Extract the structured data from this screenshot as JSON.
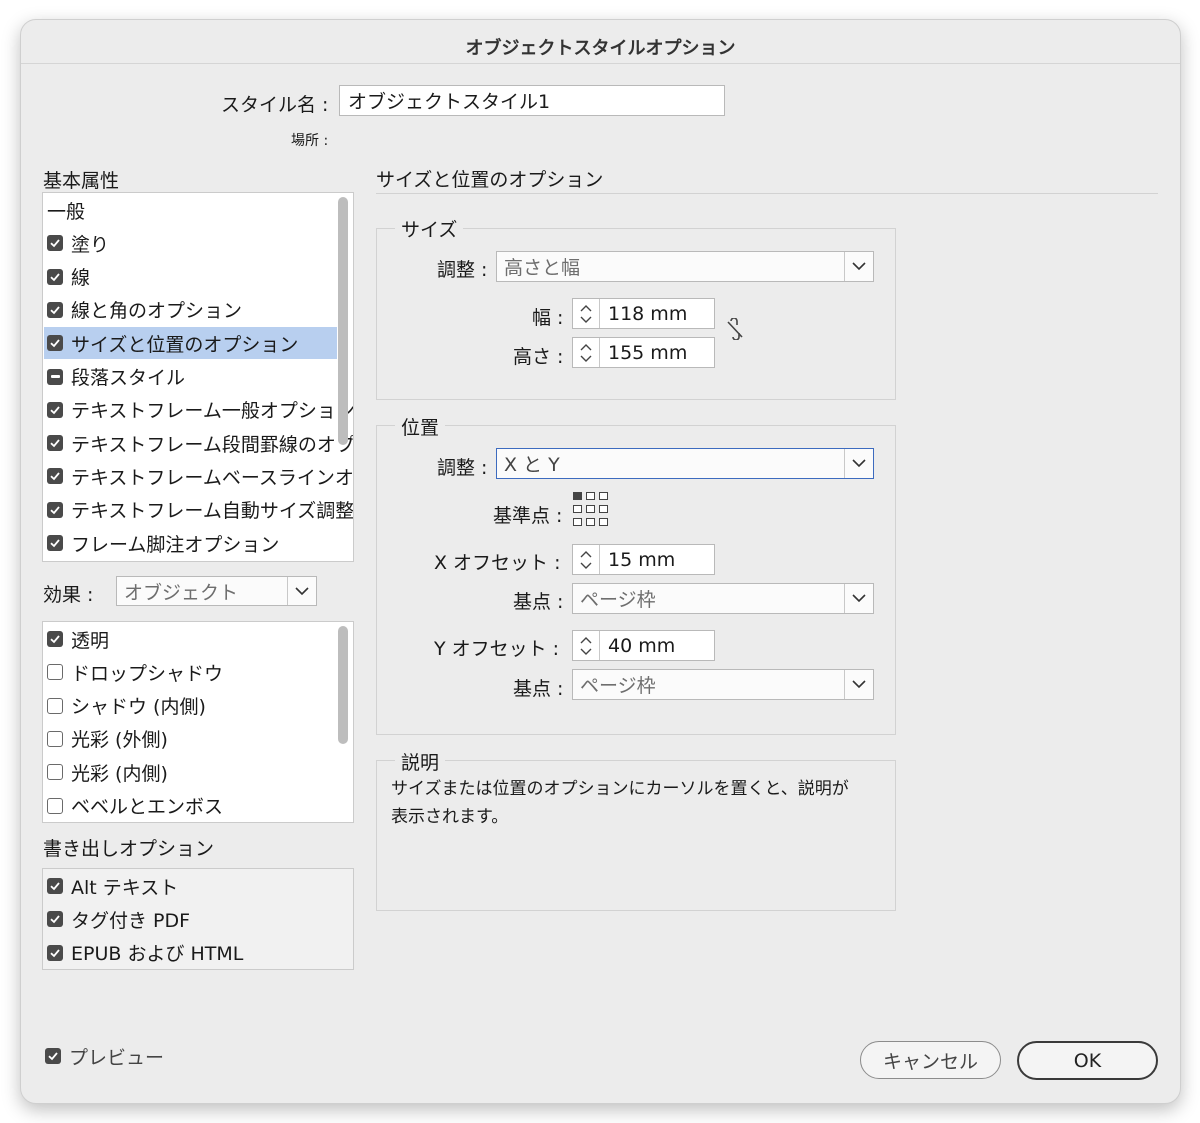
{
  "window": {
    "title": "オブジェクトスタイルオプション"
  },
  "style_name": {
    "label": "スタイル名 :",
    "value": "オブジェクトスタイル1"
  },
  "location": {
    "label": "場所 :"
  },
  "basic_attributes": {
    "heading": "基本属性",
    "items": [
      {
        "label": "一般",
        "state": "none"
      },
      {
        "label": "塗り",
        "state": "checked"
      },
      {
        "label": "線",
        "state": "checked"
      },
      {
        "label": "線と角のオプション",
        "state": "checked"
      },
      {
        "label": "サイズと位置のオプション",
        "state": "checked",
        "selected": true
      },
      {
        "label": "段落スタイル",
        "state": "mixed"
      },
      {
        "label": "テキストフレーム一般オプション",
        "state": "checked"
      },
      {
        "label": "テキストフレーム段間罫線のオプション",
        "state": "checked"
      },
      {
        "label": "テキストフレームベースラインオプション",
        "state": "checked"
      },
      {
        "label": "テキストフレーム自動サイズ調整オプション",
        "state": "checked"
      },
      {
        "label": "フレーム脚注オプション",
        "state": "checked"
      }
    ]
  },
  "effects": {
    "label": "効果 :",
    "dropdown_value": "オブジェクト",
    "items": [
      {
        "label": "透明",
        "state": "checked"
      },
      {
        "label": "ドロップシャドウ",
        "state": "off"
      },
      {
        "label": "シャドウ (内側)",
        "state": "off"
      },
      {
        "label": "光彩 (外側)",
        "state": "off"
      },
      {
        "label": "光彩 (内側)",
        "state": "off"
      },
      {
        "label": "ベベルとエンボス",
        "state": "off"
      }
    ]
  },
  "export_options": {
    "heading": "書き出しオプション",
    "items": [
      {
        "label": "Alt テキスト",
        "state": "checked"
      },
      {
        "label": "タグ付き PDF",
        "state": "checked"
      },
      {
        "label": "EPUB および HTML",
        "state": "checked"
      }
    ]
  },
  "panel": {
    "title": "サイズと位置のオプション",
    "size": {
      "title": "サイズ",
      "adjust_label": "調整 :",
      "adjust_value": "高さと幅",
      "width_label": "幅 :",
      "width_value": "118 mm",
      "height_label": "高さ :",
      "height_value": "155 mm"
    },
    "position": {
      "title": "位置",
      "adjust_label": "調整 :",
      "adjust_value": "X と Y",
      "reference_label": "基準点 :",
      "x_offset_label": "X オフセット :",
      "x_offset_value": "15 mm",
      "x_origin_label": "基点 :",
      "x_origin_value": "ページ枠",
      "y_offset_label": "Y オフセット :",
      "y_offset_value": "40 mm",
      "y_origin_label": "基点 :",
      "y_origin_value": "ページ枠"
    },
    "description": {
      "title": "説明",
      "text_line1": "サイズまたは位置のオプションにカーソルを置くと、説明が",
      "text_line2": "表示されます。"
    }
  },
  "preview": {
    "label": "プレビュー",
    "state": "checked"
  },
  "buttons": {
    "cancel": "キャンセル",
    "ok": "OK"
  },
  "colors": {
    "selection": "#b8cfef",
    "focus_border": "#3d6bbf",
    "dialog_bg": "#ececec"
  }
}
